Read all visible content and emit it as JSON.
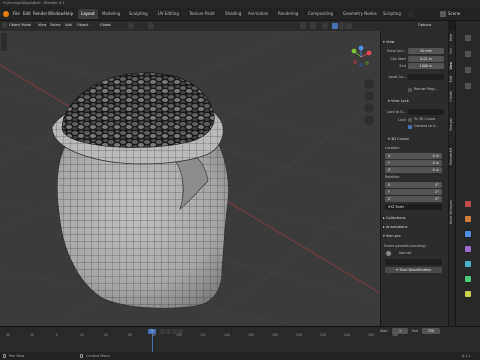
{
  "window": {
    "title": "F:\\Arrange\\Bags\\Beill - Blender 4.1"
  },
  "topbar": {
    "menus": [
      "File",
      "Edit",
      "Render",
      "Window",
      "Help"
    ],
    "workspaces": [
      "Layout",
      "Modeling",
      "Sculpting",
      "UV Editing",
      "Texture Paint",
      "Shading",
      "Animation",
      "Rendering",
      "Compositing",
      "Geometry Nodes",
      "Scripting"
    ],
    "scene_label": "Scene"
  },
  "header2": {
    "items": [
      "Object Mode",
      "View",
      "Select",
      "Add",
      "Object"
    ],
    "global": "Global",
    "options": "Options"
  },
  "npanel": {
    "view_section": "View",
    "focal_label": "Focal Len...",
    "focal_value": "50 mm",
    "clip_start_label": "Clip Start",
    "clip_start_value": "0.01 m",
    "end_label": "End",
    "end_value": "1000 m",
    "local_camera_label": "Local Ca...",
    "render_region_label": "Render Regi...",
    "view_lock_section": "View Lock",
    "lock_to_object_label": "Lock to O...",
    "lock_label": "Lock",
    "lock_cursor_label": "To 3D Cursor",
    "lock_camera_label": "Camera to V...",
    "cursor_section": "3D Cursor",
    "location_label": "Location:",
    "loc_x": "0 m",
    "loc_y": "0 m",
    "loc_z": "0 m",
    "rotation_label": "Rotation:",
    "rot_x": "0°",
    "rot_y": "0°",
    "rot_z": "0°",
    "rot_mode": "XYZ Euler",
    "collections_section": "Collections",
    "annotations_section": "Annotations",
    "ssm_section": "Ssm.pro",
    "scene_geom_label": "Scene geometry/scaling :",
    "not_set_label": "Not set",
    "start_btn": "Start Beautification"
  },
  "vertical_tabs": [
    "Item",
    "Tool",
    "View",
    "Edit",
    "Create",
    "Ssm.pro",
    "BlenderKit",
    "Node Wrangler"
  ],
  "timeline": {
    "ticks": [
      "40",
      "20",
      "0",
      "20",
      "40",
      "60",
      "80",
      "100",
      "120",
      "140",
      "160",
      "180",
      "200",
      "220",
      "240",
      "260",
      "280"
    ],
    "current_frame": "1",
    "start_label": "Start",
    "start_value": "1",
    "end_label": "End",
    "end_value": "250"
  },
  "statusbar": {
    "pan": "Pan View",
    "context": "Context Menu",
    "version": "4.1.1"
  },
  "colors": {
    "accent": "#4772b3",
    "viewport_bg": "#3b3b3b",
    "panel_bg": "#2c2c2c",
    "x_axis": "#e04a52",
    "y_axis": "#7bbf3b",
    "z_axis": "#4f8ee3"
  }
}
